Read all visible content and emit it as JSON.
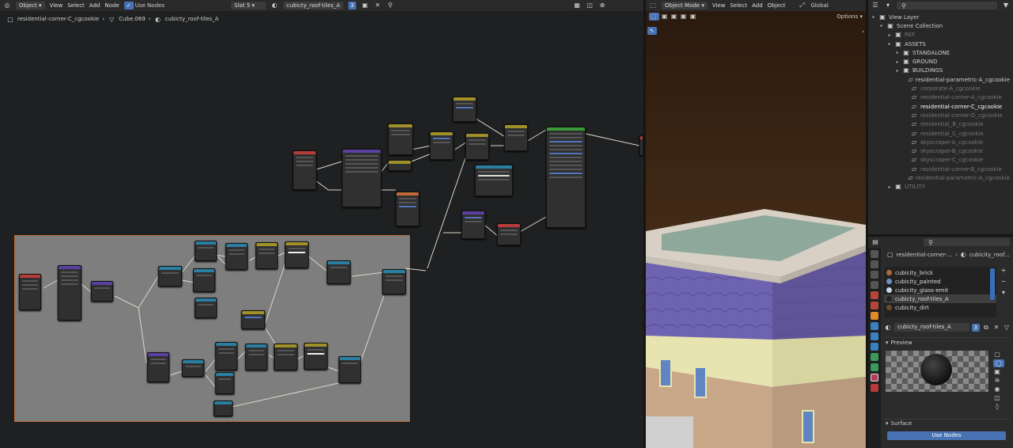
{
  "node_editor": {
    "mode": "Object",
    "menus": [
      "View",
      "Select",
      "Add",
      "Node"
    ],
    "use_nodes": "Use Nodes",
    "slot": "Slot 5",
    "material": "cubicty_roof-tiles_A",
    "users": "3",
    "breadcrumb": [
      "residential-corner-C_cgcookie",
      "Cube.069",
      "cubicty_roof-tiles_A"
    ]
  },
  "viewport": {
    "mode": "Object Mode",
    "menus": [
      "View",
      "Select",
      "Add",
      "Object"
    ],
    "transform": "Global",
    "options": "Options"
  },
  "outliner": {
    "items": [
      {
        "label": "View Layer",
        "indent": 0,
        "state": "normal"
      },
      {
        "label": "Scene Collection",
        "indent": 1,
        "state": "normal"
      },
      {
        "label": "REF",
        "indent": 2,
        "state": "dim"
      },
      {
        "label": "ASSETS",
        "indent": 2,
        "state": "normal"
      },
      {
        "label": "STANDALONE",
        "indent": 3,
        "state": "normal"
      },
      {
        "label": "GROUND",
        "indent": 3,
        "state": "normal"
      },
      {
        "label": "BUILDINGS",
        "indent": 3,
        "state": "normal"
      },
      {
        "label": "residential-parametric-A_cgcookie",
        "indent": 4,
        "state": "normal"
      },
      {
        "label": "corporate-A_cgcookie",
        "indent": 4,
        "state": "dim"
      },
      {
        "label": "residential-corner-A_cgcookie",
        "indent": 4,
        "state": "dim"
      },
      {
        "label": "residential-corner-C_cgcookie",
        "indent": 4,
        "state": "hl"
      },
      {
        "label": "residential-corner-D_cgcookie",
        "indent": 4,
        "state": "dim"
      },
      {
        "label": "residential_B_cgcookie",
        "indent": 4,
        "state": "dim"
      },
      {
        "label": "residential_C_cgcookie",
        "indent": 4,
        "state": "dim"
      },
      {
        "label": "skyscraper-A_cgcookie",
        "indent": 4,
        "state": "dim"
      },
      {
        "label": "skyscraper-B_cgcookie",
        "indent": 4,
        "state": "dim"
      },
      {
        "label": "skyscraper-C_cgcookie",
        "indent": 4,
        "state": "dim"
      },
      {
        "label": "residential-corner-B_cgcookie",
        "indent": 4,
        "state": "dim"
      },
      {
        "label": "residential-parametric-A_cgcookie",
        "indent": 4,
        "state": "dim"
      },
      {
        "label": "UTILITY",
        "indent": 2,
        "state": "dim"
      }
    ]
  },
  "properties": {
    "breadcrumb": [
      "residential-corner-...",
      "cubicity_roof..."
    ],
    "materials": [
      {
        "label": "cubicity_brick",
        "color": "#b06a3a"
      },
      {
        "label": "cubicity_painted",
        "color": "#6a8fbf"
      },
      {
        "label": "cubicity_glass-emit",
        "color": "#c8d8e8"
      },
      {
        "label": "cubicty_roof-tiles_A",
        "color": "#222222",
        "selected": true
      },
      {
        "label": "cubicity_dirt",
        "color": "#6a4a2a"
      }
    ],
    "material_name": "cubicty_roof-tiles_A",
    "users": "3",
    "preview_label": "Preview",
    "surface_label": "Surface",
    "use_nodes_btn": "Use Nodes"
  }
}
